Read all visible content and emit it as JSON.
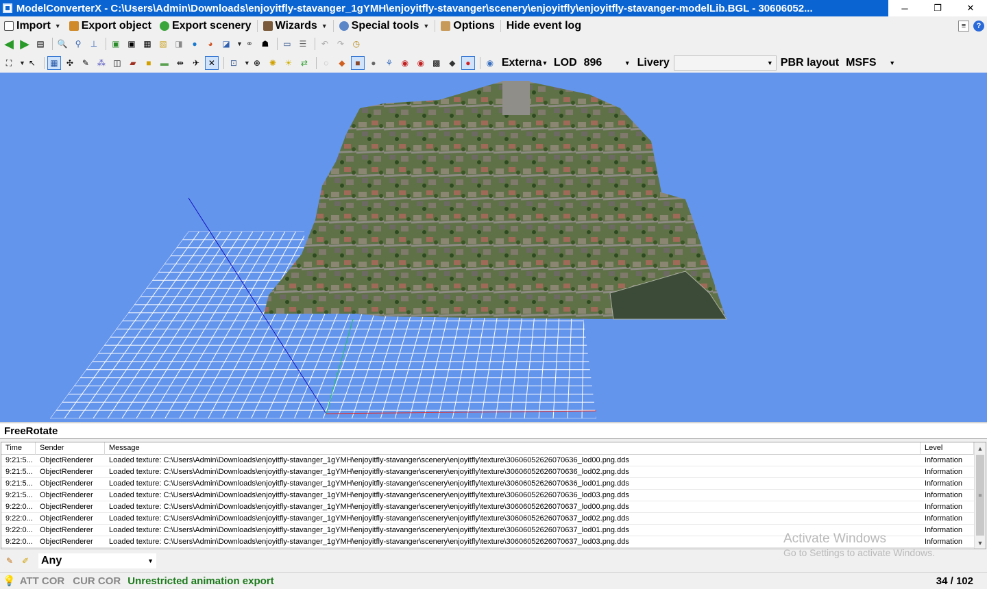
{
  "window": {
    "title": "ModelConverterX - C:\\Users\\Admin\\Downloads\\enjoyitfly-stavanger_1gYMH\\enjoyitfly-stavanger\\scenery\\enjoyitfly\\enjoyitfly-stavanger-modelLib.BGL - 30606052...",
    "minimize_glyph": "─",
    "restore_glyph": "❐",
    "close_glyph": "✕"
  },
  "menu": {
    "import": "Import",
    "export_object": "Export object",
    "export_scenery": "Export scenery",
    "wizards": "Wizards",
    "special_tools": "Special tools",
    "options": "Options",
    "hide_event_log": "Hide event log",
    "help_glyph": "?"
  },
  "toolbar2": {
    "external_label": "Externa",
    "lod_label": "LOD",
    "lod_value": "896",
    "livery_label": "Livery",
    "livery_value": "",
    "pbr_label": "PBR layout",
    "pbr_value": "MSFS"
  },
  "mode": "FreeRotate",
  "log": {
    "headers": {
      "time": "Time",
      "sender": "Sender",
      "message": "Message",
      "level": "Level"
    },
    "rows": [
      {
        "time": "9:21:5...",
        "sender": "ObjectRenderer",
        "message": "Loaded texture: C:\\Users\\Admin\\Downloads\\enjoyitfly-stavanger_1gYMH\\enjoyitfly-stavanger\\scenery\\enjoyitfly\\texture\\30606052626070636_lod00.png.dds",
        "level": "Information"
      },
      {
        "time": "9:21:5...",
        "sender": "ObjectRenderer",
        "message": "Loaded texture: C:\\Users\\Admin\\Downloads\\enjoyitfly-stavanger_1gYMH\\enjoyitfly-stavanger\\scenery\\enjoyitfly\\texture\\30606052626070636_lod02.png.dds",
        "level": "Information"
      },
      {
        "time": "9:21:5...",
        "sender": "ObjectRenderer",
        "message": "Loaded texture: C:\\Users\\Admin\\Downloads\\enjoyitfly-stavanger_1gYMH\\enjoyitfly-stavanger\\scenery\\enjoyitfly\\texture\\30606052626070636_lod01.png.dds",
        "level": "Information"
      },
      {
        "time": "9:21:5...",
        "sender": "ObjectRenderer",
        "message": "Loaded texture: C:\\Users\\Admin\\Downloads\\enjoyitfly-stavanger_1gYMH\\enjoyitfly-stavanger\\scenery\\enjoyitfly\\texture\\30606052626070636_lod03.png.dds",
        "level": "Information"
      },
      {
        "time": "9:22:0...",
        "sender": "ObjectRenderer",
        "message": "Loaded texture: C:\\Users\\Admin\\Downloads\\enjoyitfly-stavanger_1gYMH\\enjoyitfly-stavanger\\scenery\\enjoyitfly\\texture\\30606052626070637_lod00.png.dds",
        "level": "Information"
      },
      {
        "time": "9:22:0...",
        "sender": "ObjectRenderer",
        "message": "Loaded texture: C:\\Users\\Admin\\Downloads\\enjoyitfly-stavanger_1gYMH\\enjoyitfly-stavanger\\scenery\\enjoyitfly\\texture\\30606052626070637_lod02.png.dds",
        "level": "Information"
      },
      {
        "time": "9:22:0...",
        "sender": "ObjectRenderer",
        "message": "Loaded texture: C:\\Users\\Admin\\Downloads\\enjoyitfly-stavanger_1gYMH\\enjoyitfly-stavanger\\scenery\\enjoyitfly\\texture\\30606052626070637_lod01.png.dds",
        "level": "Information"
      },
      {
        "time": "9:22:0...",
        "sender": "ObjectRenderer",
        "message": "Loaded texture: C:\\Users\\Admin\\Downloads\\enjoyitfly-stavanger_1gYMH\\enjoyitfly-stavanger\\scenery\\enjoyitfly\\texture\\30606052626070637_lod03.png.dds",
        "level": "Information"
      }
    ]
  },
  "watermark": {
    "line1": "Activate Windows",
    "line2": "Go to Settings to activate Windows."
  },
  "filter": {
    "level_value": "Any"
  },
  "status": {
    "att_cor": "ATT COR",
    "cur_cor": "CUR COR",
    "animation": "Unrestricted animation export",
    "count": "34 / 102"
  },
  "colors": {
    "titlebar": "#0a64d2",
    "viewport_bg": "#6495ed",
    "grid": "#ffffff",
    "axis_x": "#e03030",
    "axis_y": "#20c060",
    "axis_z": "#1010c0",
    "status_green": "#1a7a1a"
  }
}
